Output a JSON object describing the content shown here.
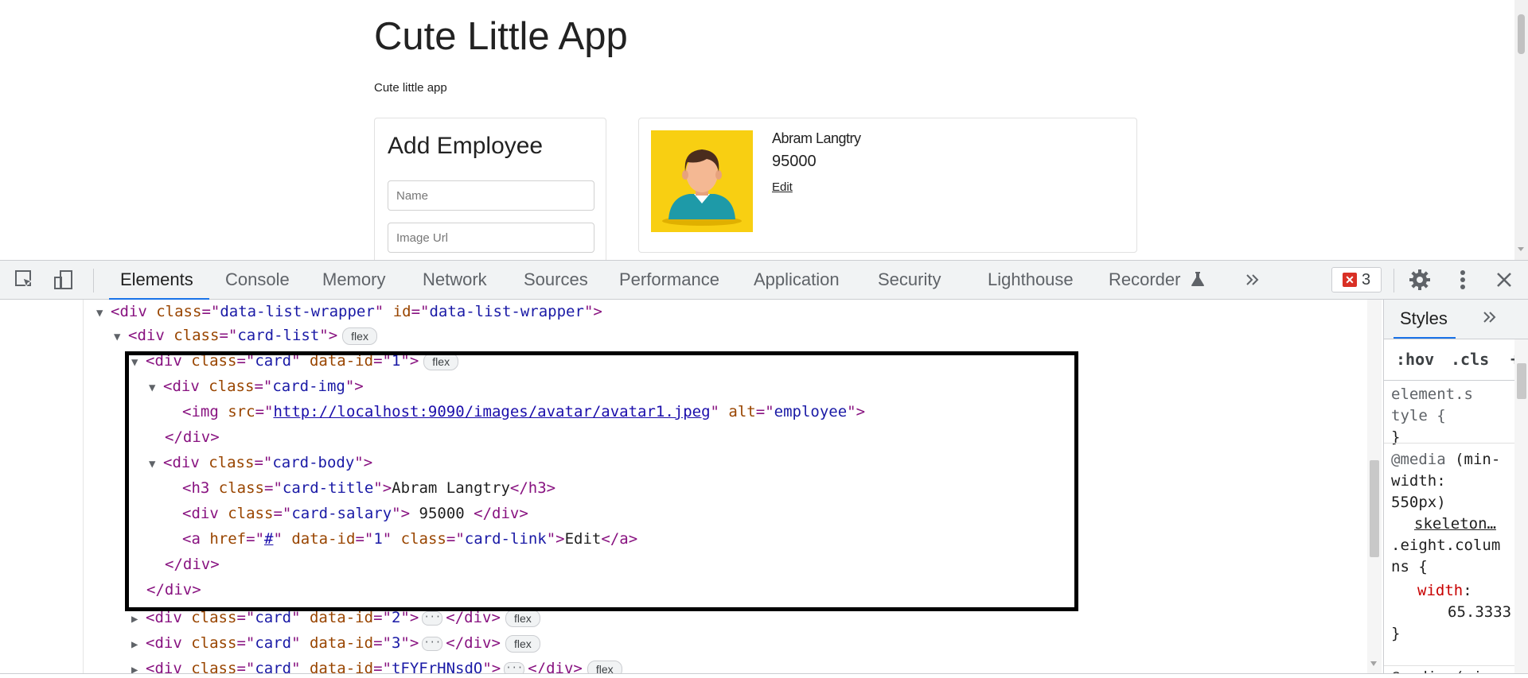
{
  "page": {
    "title": "Cute Little App",
    "subtitle": "Cute little app",
    "add_form": {
      "heading": "Add Employee",
      "name_placeholder": "Name",
      "image_placeholder": "Image Url"
    },
    "card": {
      "name": "Abram Langtry",
      "salary": "95000",
      "edit_label": "Edit",
      "avatar_bg": "#f8cf12"
    }
  },
  "devtools": {
    "tabs": [
      "Elements",
      "Console",
      "Memory",
      "Network",
      "Sources",
      "Performance",
      "Application",
      "Security",
      "Lighthouse",
      "Recorder"
    ],
    "active_tab": "Elements",
    "error_count": "3",
    "accent_color": "#1a73e8",
    "error_color": "#d93025"
  },
  "elements_tree": {
    "flex_badge": "flex",
    "line1": {
      "tag": "div",
      "class_attr": "class",
      "class_val": "data-list-wrapper",
      "id_attr": "id",
      "id_val": "data-list-wrapper"
    },
    "line2": {
      "tag": "div",
      "class_attr": "class",
      "class_val": "card-list"
    },
    "line3": {
      "tag": "div",
      "class_attr": "class",
      "class_val": "card",
      "data_attr": "data-id",
      "data_val": "1"
    },
    "line4": {
      "tag": "div",
      "class_attr": "class",
      "class_val": "card-img"
    },
    "line5": {
      "tag": "img",
      "src_attr": "src",
      "src_val": "http://localhost:9090/images/avatar/avatar1.jpeg",
      "alt_attr": "alt",
      "alt_val": "employee"
    },
    "line6": {
      "close": "</div>"
    },
    "line7": {
      "tag": "div",
      "class_attr": "class",
      "class_val": "card-body"
    },
    "line8": {
      "tag": "h3",
      "class_attr": "class",
      "class_val": "card-title",
      "text": "Abram Langtry",
      "close": "</h3>"
    },
    "line9": {
      "tag": "div",
      "class_attr": "class",
      "class_val": "card-salary",
      "text": " 95000 ",
      "close": "</div>"
    },
    "line10": {
      "tag": "a",
      "href_attr": "href",
      "href_val": "#",
      "data_attr": "data-id",
      "data_val": "1",
      "class_attr": "class",
      "class_val": "card-link",
      "text": "Edit",
      "close": "</a>"
    },
    "line11": {
      "close": "</div>"
    },
    "line12": {
      "close": "</div>"
    },
    "line13": {
      "tag": "div",
      "class_attr": "class",
      "class_val": "card",
      "data_attr": "data-id",
      "data_val": "2",
      "close": "</div>"
    },
    "line14": {
      "tag": "div",
      "class_attr": "class",
      "class_val": "card",
      "data_attr": "data-id",
      "data_val": "3",
      "close": "</div>"
    },
    "line15": {
      "tag": "div",
      "class_attr": "class",
      "class_val": "card",
      "data_attr": "data-id",
      "data_val": "tFYFrHNsdO",
      "close": "</div>"
    }
  },
  "styles_pane": {
    "tab_label": "Styles",
    "hov": ":hov",
    "cls": ".cls",
    "plus": "+",
    "element_style_1": "element.s",
    "element_style_2": "tyle {",
    "close_brace": "}",
    "media_1_kw": "@media",
    "media_1_rest": " (min-",
    "media_2": "width:",
    "media_3": "550px)",
    "source": "skeleton…",
    "selector_1": ".eight.colum",
    "selector_2": "ns {",
    "prop_name": "width",
    "prop_colon": ":",
    "prop_value": "65.3333",
    "media_bottom": "@media (min-"
  }
}
